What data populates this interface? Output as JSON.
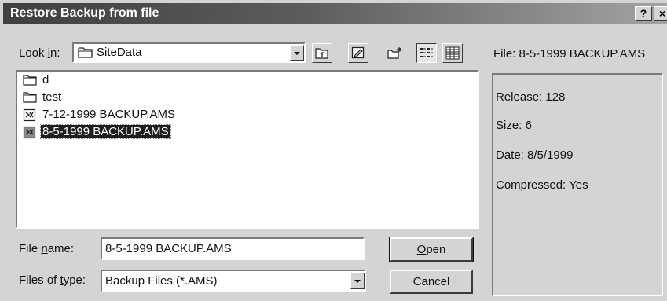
{
  "window": {
    "title": "Restore Backup from file",
    "help_button": "?",
    "close_button": "×"
  },
  "look_in": {
    "label_prefix": "Look ",
    "label_mnemonic": "i",
    "label_suffix": "n:",
    "value": "SiteData"
  },
  "toolbar": {
    "buttons": [
      "up-one-level",
      "desktop",
      "create-new-folder",
      "list-view",
      "details-view"
    ],
    "active_view": "list-view"
  },
  "file_list": {
    "items": [
      {
        "name": "d",
        "type": "folder",
        "selected": false
      },
      {
        "name": "test",
        "type": "folder",
        "selected": false
      },
      {
        "name": "7-12-1999 BACKUP.AMS",
        "type": "backup-file",
        "selected": false
      },
      {
        "name": "8-5-1999 BACKUP.AMS",
        "type": "backup-file",
        "selected": true
      }
    ]
  },
  "file_name": {
    "label_prefix": "File ",
    "label_mnemonic": "n",
    "label_suffix": "ame:",
    "value": "8-5-1999 BACKUP.AMS"
  },
  "files_of_type": {
    "label_prefix": "Files of ",
    "label_mnemonic": "t",
    "label_suffix": "ype:",
    "value": "Backup Files (*.AMS)"
  },
  "buttons": {
    "open_mnemonic": "O",
    "open_rest": "pen",
    "cancel": "Cancel"
  },
  "info": {
    "file": "File: 8-5-1999 BACKUP.AMS",
    "release": "Release: 128",
    "size": "Size: 6",
    "date": "Date: 8/5/1999",
    "compressed": "Compressed: Yes"
  },
  "colors": {
    "titlebar": "#3f3f3f",
    "dialog_face": "#d4d4d4",
    "selection": "#1e1e1e"
  }
}
